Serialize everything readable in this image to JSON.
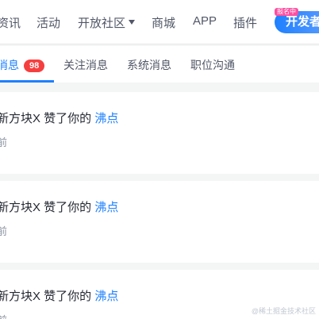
{
  "topnav": {
    "items": [
      "资讯",
      "活动",
      "开放社区",
      "商城",
      "APP",
      "插件"
    ],
    "dev_badge": "开发者",
    "dev_badge_tag": "报名中"
  },
  "tabs": {
    "items": [
      {
        "label": "消息",
        "badge": "98"
      },
      {
        "label": "关注消息"
      },
      {
        "label": "系统消息"
      },
      {
        "label": "职位沟通"
      }
    ]
  },
  "notifications": [
    {
      "text": "新方块X 赞了你的",
      "link": "沸点",
      "time": "前"
    },
    {
      "text": "新方块X 赞了你的",
      "link": "沸点",
      "time": "前"
    },
    {
      "text": "新方块X 赞了你的",
      "link": "沸点",
      "time": "前"
    }
  ],
  "watermark": "@稀土掘金技术社区",
  "colors": {
    "accent": "#1e80ff",
    "badge": "#f53f3f"
  }
}
